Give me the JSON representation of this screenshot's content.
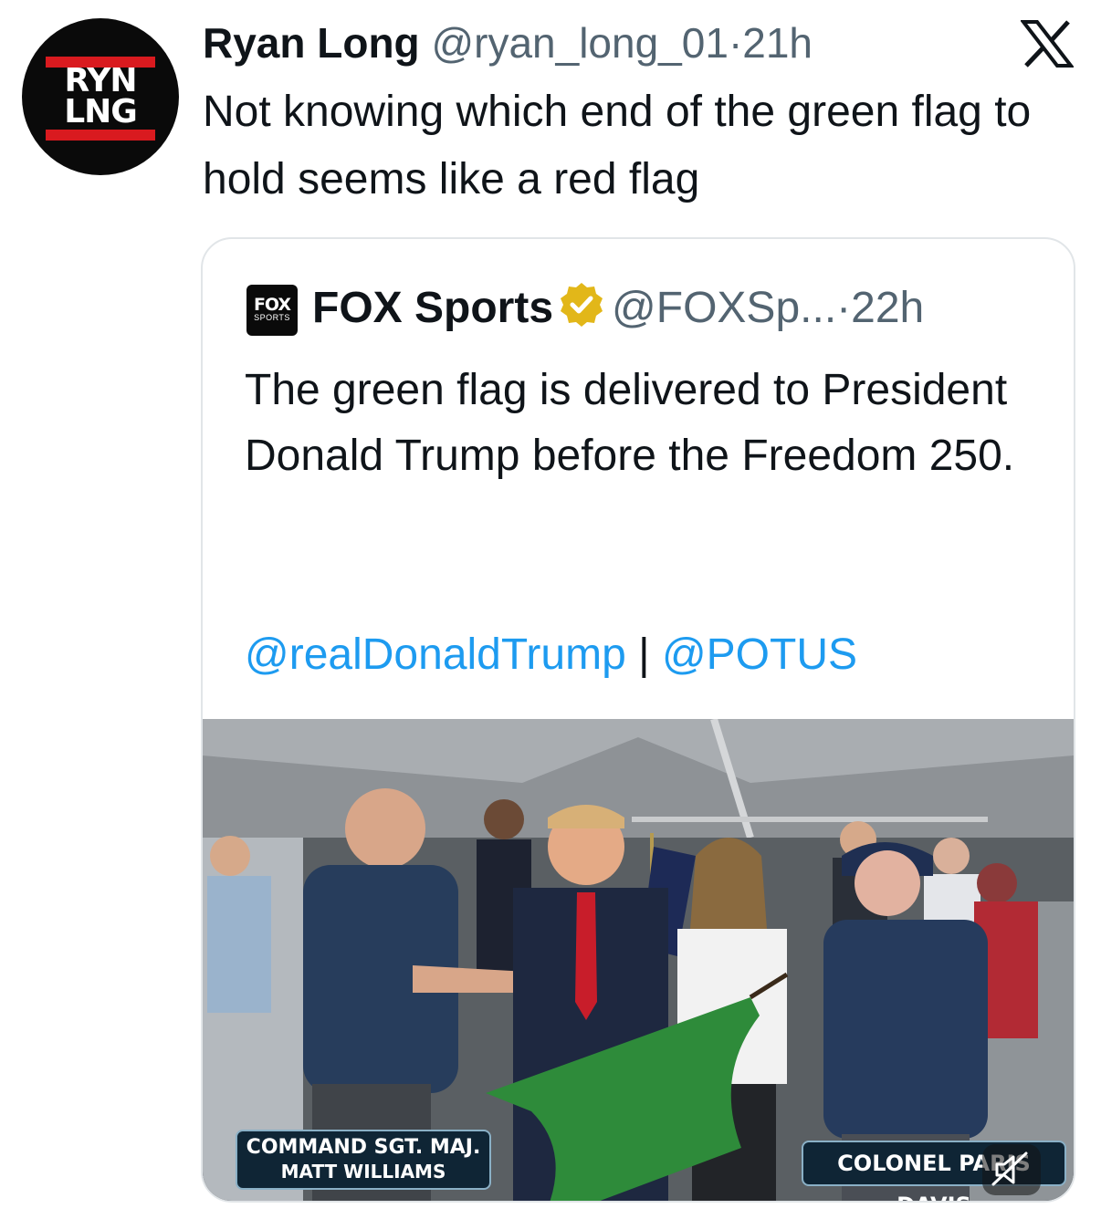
{
  "tweet": {
    "avatar_text": "RYN\nLNG",
    "display_name": "Ryan Long",
    "handle": "@ryan_long_01",
    "separator": "·",
    "time": "21h",
    "text": "Not knowing which end of the green flag to hold seems like a red flag"
  },
  "quoted": {
    "avatar_text_top": "FOX",
    "avatar_text_bottom": "SPORTS",
    "display_name": "FOX Sports",
    "verified": true,
    "handle": "@FOXSp...",
    "separator": "·",
    "time": "22h",
    "text": "The green flag is delivered to President Donald Trump before the Freedom 250.",
    "mention_1": "@realDonaldTrump",
    "mention_separator": "|",
    "mention_2": "@POTUS",
    "media": {
      "caption_left_line1": "COMMAND SGT. MAJ.",
      "caption_left_line2": "MATT WILLIAMS",
      "caption_right": "COLONEL PARIS DAVIS"
    }
  },
  "icons": {
    "platform_logo": "x-logo-icon",
    "verified": "verified-badge-icon",
    "mute": "muted-speaker-icon"
  },
  "colors": {
    "link": "#1d9bf0",
    "meta_text": "#536471",
    "verified_badge": "#e2b719",
    "avatar_bar": "#d91a1f"
  }
}
